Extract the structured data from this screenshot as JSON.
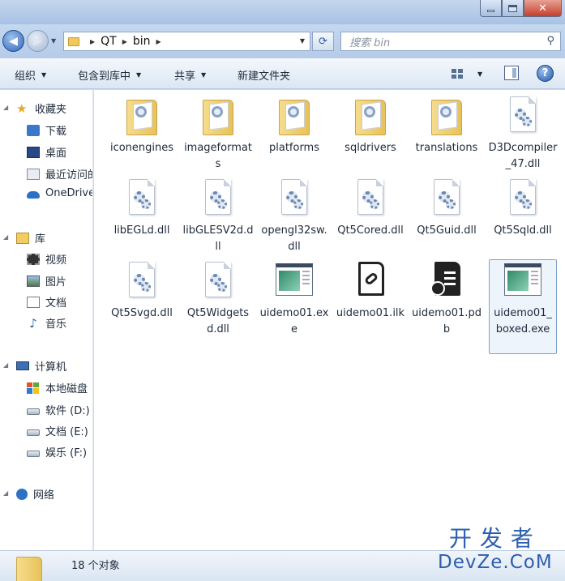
{
  "window": {
    "controls": {
      "minimize": "minimize-icon",
      "maximize": "maximize-icon",
      "close": "✕"
    }
  },
  "address": {
    "crumbs": [
      "QT",
      "bin"
    ],
    "refresh_icon": "refresh-icon",
    "search_placeholder": "搜索 bin"
  },
  "toolbar": {
    "organize": "组织",
    "include_in_library": "包含到库中",
    "share": "共享",
    "new_folder": "新建文件夹",
    "help": "?"
  },
  "nav": {
    "favorites": "收藏夹",
    "downloads": "下载",
    "desktop": "桌面",
    "recent": "最近访问的位置",
    "onedrive": "OneDrive",
    "libraries": "库",
    "videos": "视频",
    "pictures": "图片",
    "documents": "文档",
    "music": "音乐",
    "computer": "计算机",
    "local_disk": "本地磁盘",
    "disk_d": "软件 (D:)",
    "disk_e": "文档 (E:)",
    "disk_f": "娱乐 (F:)",
    "network": "网络"
  },
  "files": [
    {
      "name": "iconengines",
      "type": "folder"
    },
    {
      "name": "imageformats",
      "type": "folder"
    },
    {
      "name": "platforms",
      "type": "folder"
    },
    {
      "name": "sqldrivers",
      "type": "folder"
    },
    {
      "name": "translations",
      "type": "folder"
    },
    {
      "name": "D3Dcompiler_47.dll",
      "type": "dll"
    },
    {
      "name": "libEGLd.dll",
      "type": "dll"
    },
    {
      "name": "libGLESV2d.dll",
      "type": "dll"
    },
    {
      "name": "opengl32sw.dll",
      "type": "dll"
    },
    {
      "name": "Qt5Cored.dll",
      "type": "dll"
    },
    {
      "name": "Qt5Guid.dll",
      "type": "dll"
    },
    {
      "name": "Qt5Sqld.dll",
      "type": "dll"
    },
    {
      "name": "Qt5Svgd.dll",
      "type": "dll"
    },
    {
      "name": "Qt5Widgetsd.dll",
      "type": "dll"
    },
    {
      "name": "uidemo01.exe",
      "type": "exe"
    },
    {
      "name": "uidemo01.ilk",
      "type": "ilk"
    },
    {
      "name": "uidemo01.pdb",
      "type": "pdb"
    },
    {
      "name": "uidemo01_boxed.exe",
      "type": "exe"
    }
  ],
  "status": {
    "count": "18 个对象"
  },
  "watermark": {
    "top": "开发者",
    "bottom": "DevZe.CoM"
  }
}
